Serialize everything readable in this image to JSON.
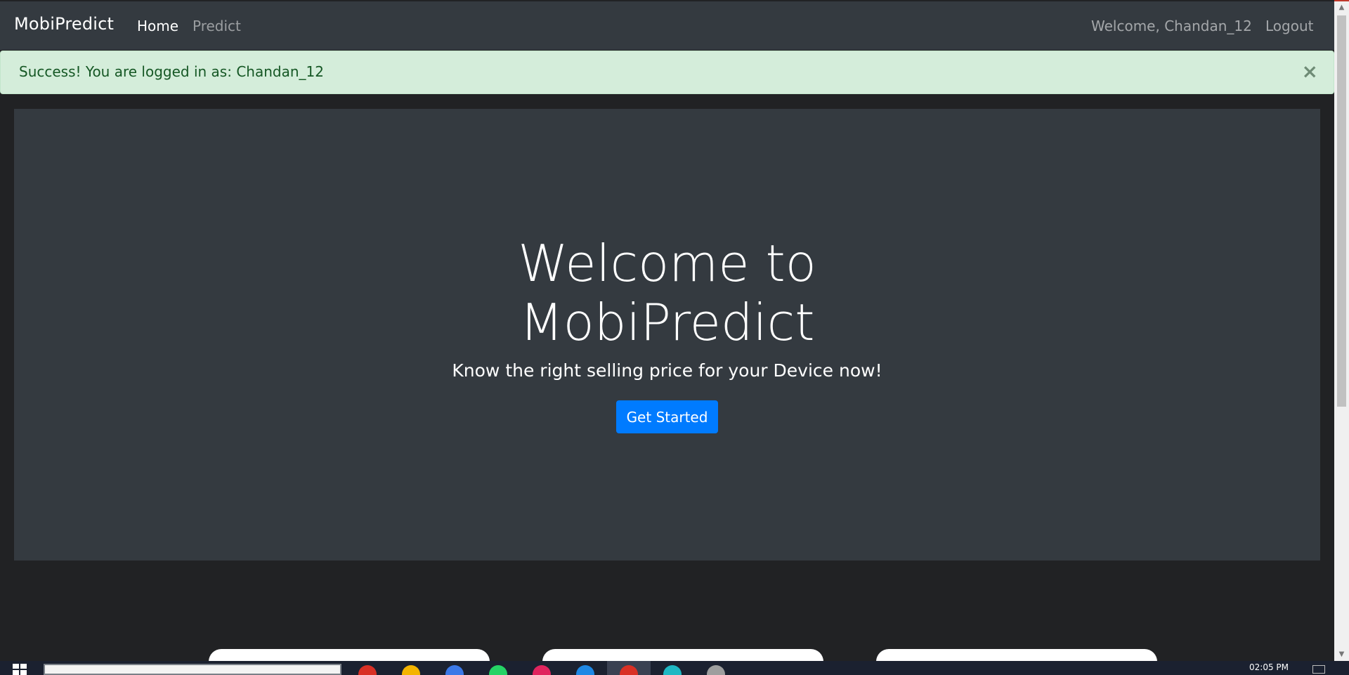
{
  "navbar": {
    "brand": "MobiPredict",
    "links": [
      {
        "label": "Home"
      },
      {
        "label": "Predict"
      }
    ],
    "welcome": "Welcome, Chandan_12",
    "logout": "Logout"
  },
  "alert": {
    "message": "Success! You are logged in as: Chandan_12",
    "close": "×"
  },
  "hero": {
    "title_line1": "Welcome to",
    "title_line2": "MobiPredict",
    "subtitle": "Know the right selling price for your Device now!",
    "button": "Get Started"
  },
  "taskbar": {
    "clock": "02:05 PM",
    "apps": [
      {
        "icon": "chrome-icon",
        "color": "#d93025"
      },
      {
        "icon": "file-explorer-icon",
        "color": "#f4b400"
      },
      {
        "icon": "document-icon",
        "color": "#3b78e7"
      },
      {
        "icon": "whatsapp-icon",
        "color": "#25d366"
      },
      {
        "icon": "opera-icon",
        "color": "#e0245e"
      },
      {
        "icon": "vscode-icon",
        "color": "#1e88e5"
      },
      {
        "icon": "chrome-active-icon",
        "color": "#d93025"
      },
      {
        "icon": "edge-icon",
        "color": "#1fb8c3"
      },
      {
        "icon": "database-icon",
        "color": "#9e9e9e"
      }
    ]
  },
  "colors": {
    "navbar_bg": "#343a40",
    "page_bg": "#212224",
    "alert_bg": "#d4edda",
    "alert_text": "#155724",
    "primary": "#007bff"
  }
}
